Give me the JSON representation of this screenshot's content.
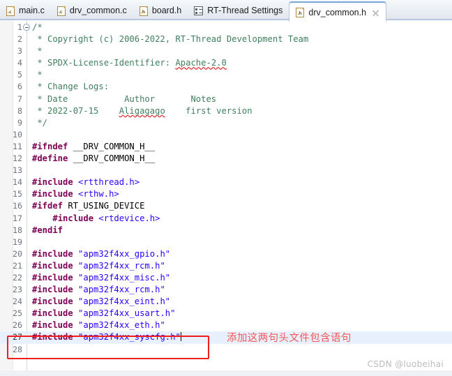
{
  "window": {
    "title": "drv_common.h"
  },
  "tabs": [
    {
      "label": "main.c",
      "icon": "c-file-icon",
      "ext": ".c",
      "active": false,
      "closable": false
    },
    {
      "label": "drv_common.c",
      "icon": "c-file-icon",
      "ext": ".c",
      "active": false,
      "closable": false
    },
    {
      "label": "board.h",
      "icon": "h-file-icon",
      "ext": ".h",
      "active": false,
      "closable": false
    },
    {
      "label": "RT-Thread Settings",
      "icon": "settings-file-icon",
      "ext": "",
      "active": false,
      "closable": false
    },
    {
      "label": "drv_common.h",
      "icon": "h-file-icon",
      "ext": ".h",
      "active": true,
      "closable": true
    }
  ],
  "editor": {
    "current_line": 27,
    "lines": [
      {
        "n": "1",
        "fold": true,
        "segments": [
          {
            "t": "/*",
            "c": "cmt"
          }
        ]
      },
      {
        "n": "2",
        "fold": false,
        "segments": [
          {
            "t": " * Copyright (c) 2006-2022, RT-Thread Development Team",
            "c": "cmt"
          }
        ]
      },
      {
        "n": "3",
        "fold": false,
        "segments": [
          {
            "t": " *",
            "c": "cmt"
          }
        ]
      },
      {
        "n": "4",
        "fold": false,
        "segments": [
          {
            "t": " * SPDX-License-Identifier: ",
            "c": "cmt"
          },
          {
            "t": "Apache-2.0",
            "c": "cmt spell"
          }
        ]
      },
      {
        "n": "5",
        "fold": false,
        "segments": [
          {
            "t": " *",
            "c": "cmt"
          }
        ]
      },
      {
        "n": "6",
        "fold": false,
        "segments": [
          {
            "t": " * Change Logs:",
            "c": "cmt"
          }
        ]
      },
      {
        "n": "7",
        "fold": false,
        "segments": [
          {
            "t": " * Date           Author       Notes",
            "c": "cmt"
          }
        ]
      },
      {
        "n": "8",
        "fold": false,
        "segments": [
          {
            "t": " * 2022-07-15    ",
            "c": "cmt"
          },
          {
            "t": "Aligagago",
            "c": "cmt spell"
          },
          {
            "t": "    first version",
            "c": "cmt"
          }
        ]
      },
      {
        "n": "9",
        "fold": false,
        "segments": [
          {
            "t": " */",
            "c": "cmt"
          }
        ]
      },
      {
        "n": "10",
        "fold": false,
        "segments": []
      },
      {
        "n": "11",
        "fold": false,
        "segments": [
          {
            "t": "#ifndef",
            "c": "pre"
          },
          {
            "t": " __DRV_COMMON_H__",
            "c": "plain"
          }
        ]
      },
      {
        "n": "12",
        "fold": false,
        "segments": [
          {
            "t": "#define",
            "c": "pre"
          },
          {
            "t": " __DRV_COMMON_H__",
            "c": "plain"
          }
        ]
      },
      {
        "n": "13",
        "fold": false,
        "segments": []
      },
      {
        "n": "14",
        "fold": false,
        "segments": [
          {
            "t": "#include",
            "c": "pre"
          },
          {
            "t": " ",
            "c": "plain"
          },
          {
            "t": "<rtthread.h>",
            "c": "str"
          }
        ]
      },
      {
        "n": "15",
        "fold": false,
        "segments": [
          {
            "t": "#include",
            "c": "pre"
          },
          {
            "t": " ",
            "c": "plain"
          },
          {
            "t": "<rthw.h>",
            "c": "str"
          }
        ]
      },
      {
        "n": "16",
        "fold": false,
        "segments": [
          {
            "t": "#ifdef",
            "c": "pre"
          },
          {
            "t": " RT_USING_DEVICE",
            "c": "plain"
          }
        ]
      },
      {
        "n": "17",
        "fold": false,
        "segments": [
          {
            "t": "    ",
            "c": "plain"
          },
          {
            "t": "#include",
            "c": "pre"
          },
          {
            "t": " ",
            "c": "plain"
          },
          {
            "t": "<rtdevice.h>",
            "c": "str"
          }
        ]
      },
      {
        "n": "18",
        "fold": false,
        "segments": [
          {
            "t": "#endif",
            "c": "pre"
          }
        ]
      },
      {
        "n": "19",
        "fold": false,
        "segments": []
      },
      {
        "n": "20",
        "fold": false,
        "segments": [
          {
            "t": "#include",
            "c": "pre"
          },
          {
            "t": " ",
            "c": "plain"
          },
          {
            "t": "\"apm32f4xx_gpio.h\"",
            "c": "str"
          }
        ]
      },
      {
        "n": "21",
        "fold": false,
        "segments": [
          {
            "t": "#include",
            "c": "pre"
          },
          {
            "t": " ",
            "c": "plain"
          },
          {
            "t": "\"apm32f4xx_rcm.h\"",
            "c": "str"
          }
        ]
      },
      {
        "n": "22",
        "fold": false,
        "segments": [
          {
            "t": "#include",
            "c": "pre"
          },
          {
            "t": " ",
            "c": "plain"
          },
          {
            "t": "\"apm32f4xx_misc.h\"",
            "c": "str"
          }
        ]
      },
      {
        "n": "23",
        "fold": false,
        "segments": [
          {
            "t": "#include",
            "c": "pre"
          },
          {
            "t": " ",
            "c": "plain"
          },
          {
            "t": "\"apm32f4xx_rcm.h\"",
            "c": "str"
          }
        ]
      },
      {
        "n": "24",
        "fold": false,
        "segments": [
          {
            "t": "#include",
            "c": "pre"
          },
          {
            "t": " ",
            "c": "plain"
          },
          {
            "t": "\"apm32f4xx_eint.h\"",
            "c": "str"
          }
        ]
      },
      {
        "n": "25",
        "fold": false,
        "segments": [
          {
            "t": "#include",
            "c": "pre"
          },
          {
            "t": " ",
            "c": "plain"
          },
          {
            "t": "\"apm32f4xx_usart.h\"",
            "c": "str"
          }
        ]
      },
      {
        "n": "26",
        "fold": false,
        "segments": [
          {
            "t": "#include",
            "c": "pre"
          },
          {
            "t": " ",
            "c": "plain"
          },
          {
            "t": "\"apm32f4xx_eth.h\"",
            "c": "str"
          }
        ]
      },
      {
        "n": "27",
        "fold": false,
        "caret": true,
        "segments": [
          {
            "t": "#include",
            "c": "pre"
          },
          {
            "t": " ",
            "c": "plain"
          },
          {
            "t": "\"apm32f4xx_syscfg.h\"",
            "c": "str"
          }
        ]
      },
      {
        "n": "28",
        "fold": false,
        "segments": []
      }
    ]
  },
  "annotation": {
    "text": "添加这两句头文件包含语句",
    "color": "#f35757",
    "highlight_box_color": "#f01d1d"
  },
  "watermark": {
    "text": "CSDN @luobeihai",
    "color": "#bcbcbc"
  },
  "colors": {
    "comment": "#3f7f5f",
    "preprocessor": "#7f0055",
    "string": "#2a00ff",
    "plain": "#000000",
    "current_line_bg": "#e8f0fe",
    "tab_active_bg": "#ffffff",
    "tabbar_bg": "#e9edf3"
  }
}
